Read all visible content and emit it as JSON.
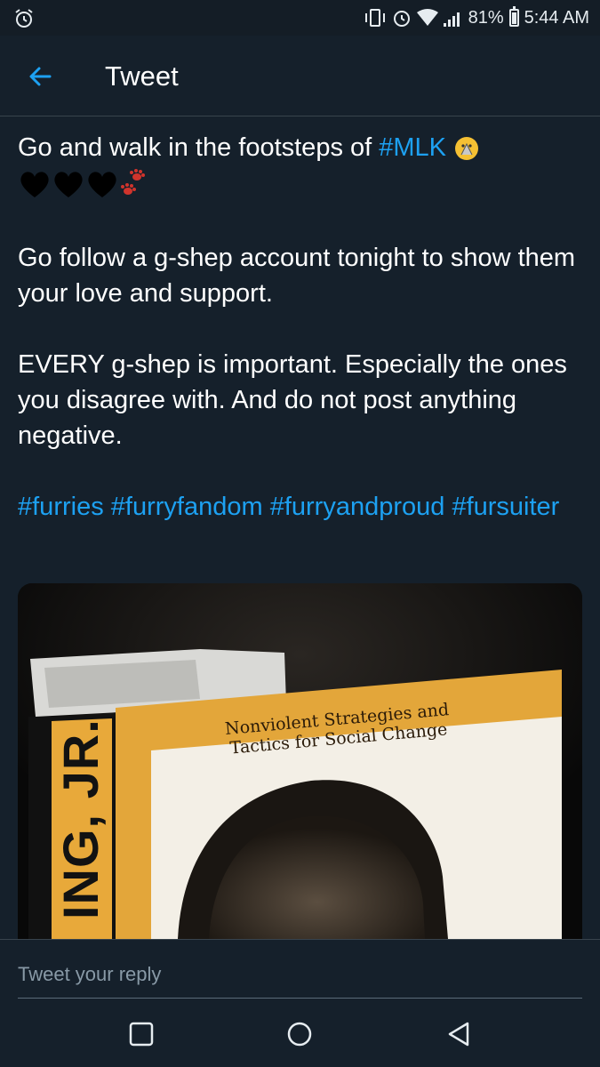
{
  "status_bar": {
    "battery_percent": "81%",
    "time": "5:44 AM",
    "icons": [
      "alarm-off-icon",
      "vibrate-icon",
      "alarm-icon",
      "wifi-icon",
      "signal-icon",
      "battery-icon"
    ]
  },
  "header": {
    "title": "Tweet",
    "back_icon": "arrow-left-icon"
  },
  "tweet": {
    "line1_text": "Go and walk in the footsteps of ",
    "line1_hashtag": "#MLK",
    "para2": "Go follow a g-shep account tonight to show them your love and support.",
    "para3": "EVERY g-shep is important. Especially the ones you disagree with. And do not post anything negative.",
    "hashtags": [
      "#furries",
      "#furryfandom",
      "#furryandproud",
      "#fursuiter"
    ],
    "emojis": [
      "praying-face-emoji",
      "black-heart-emoji",
      "black-heart-emoji",
      "black-heart-emoji",
      "paw-prints-emoji"
    ]
  },
  "media": {
    "book_title_line1": "Nonviolent Strategies and",
    "book_title_line2": "Tactics for Social Change",
    "book_spine_text": "ING, JR.",
    "colors": {
      "cover": "#e3a63a",
      "spine": "#e8a93a",
      "band": "#111111"
    }
  },
  "reply": {
    "placeholder": "Tweet your reply"
  },
  "nav": {
    "icons": [
      "recent-apps-icon",
      "home-icon",
      "back-icon"
    ]
  },
  "colors": {
    "background": "#15202b",
    "accent": "#1da1f2",
    "secondary_text": "#8899a6"
  }
}
